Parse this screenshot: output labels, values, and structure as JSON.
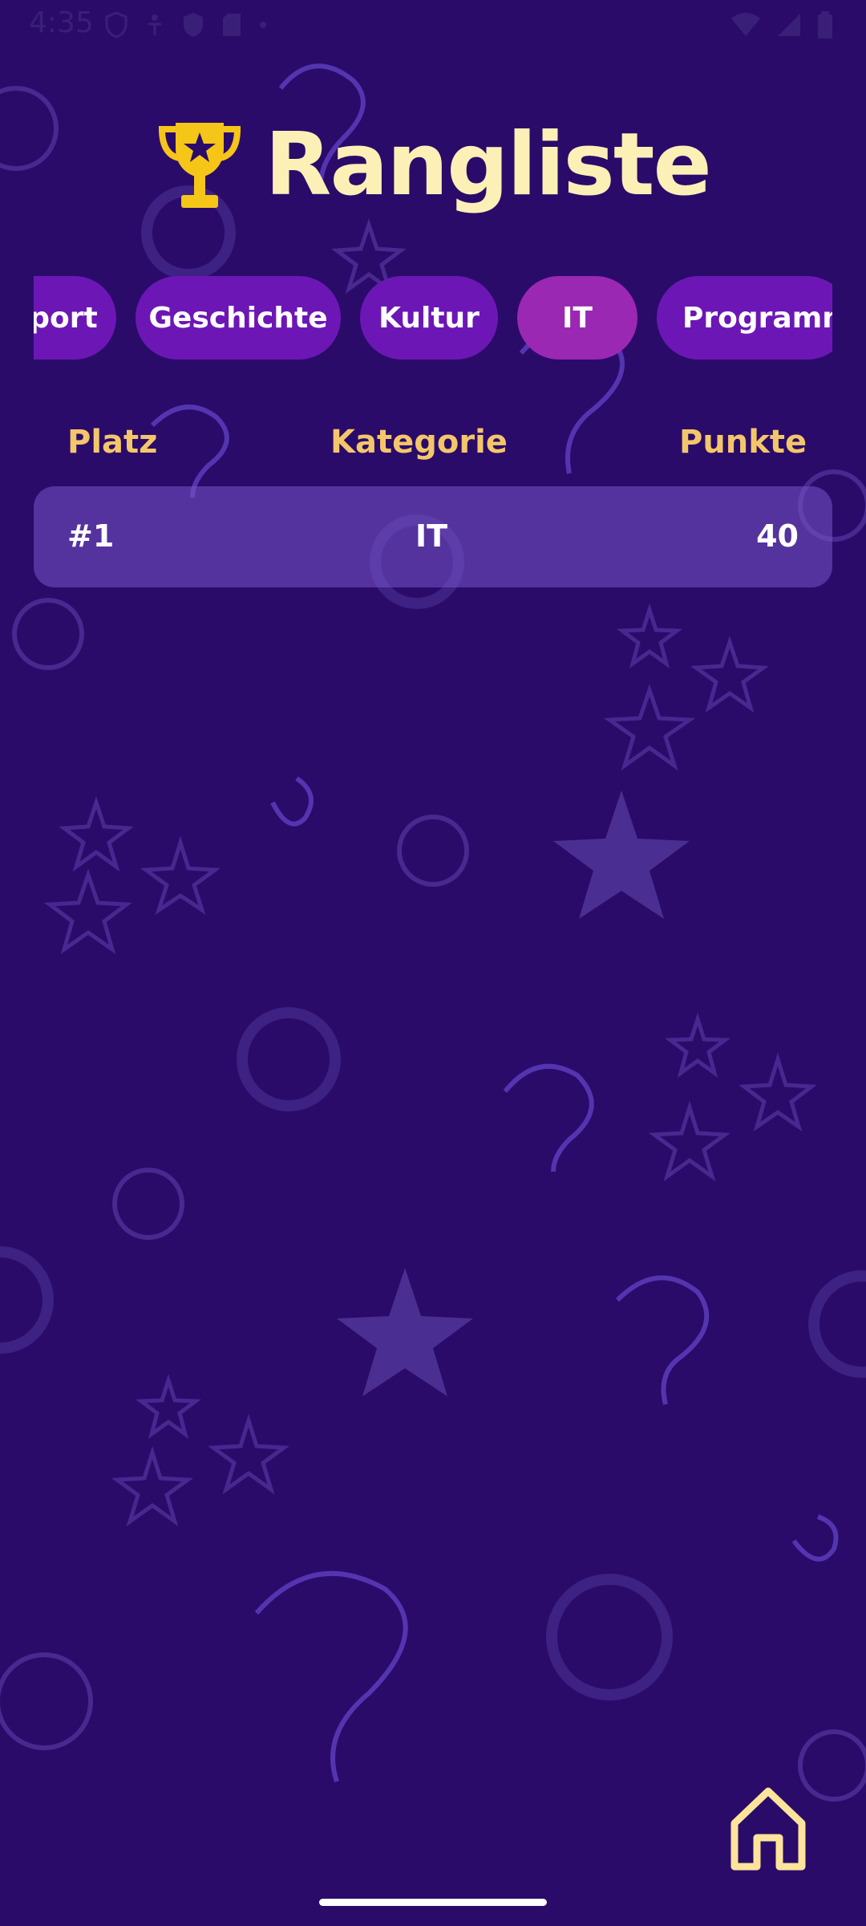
{
  "status_bar": {
    "time": "4:35"
  },
  "header": {
    "title": "Rangliste"
  },
  "categories": {
    "items": [
      {
        "label": "Sport",
        "active": false
      },
      {
        "label": "Geschichte",
        "active": false
      },
      {
        "label": "Kultur",
        "active": false
      },
      {
        "label": "IT",
        "active": true
      },
      {
        "label": "Programm",
        "active": false
      }
    ]
  },
  "table": {
    "headers": {
      "place": "Platz",
      "category": "Kategorie",
      "points": "Punkte"
    },
    "rows": [
      {
        "place": "#1",
        "category": "IT",
        "points": "40"
      }
    ]
  },
  "colors": {
    "background": "#2a0b6a",
    "chip": "#6c17b5",
    "chip_active": "#9a28b3",
    "title": "#fdf0b6",
    "header_text": "#f4c66a"
  },
  "icons": {
    "title": "trophy-icon",
    "home": "home-icon"
  }
}
